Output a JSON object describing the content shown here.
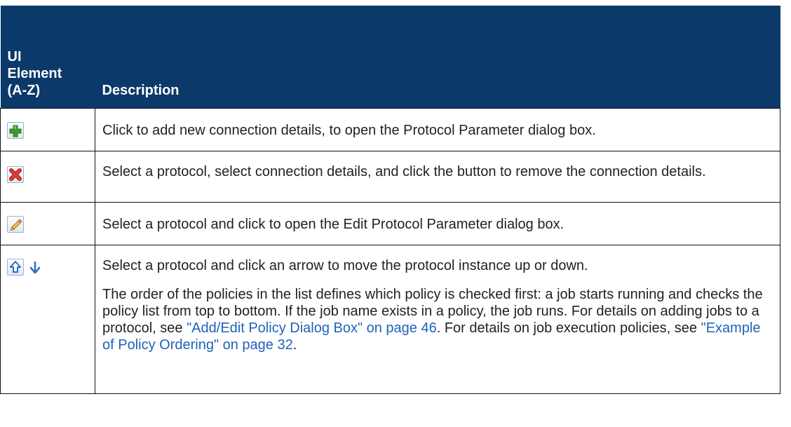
{
  "header": {
    "col1": "UI Element (A-Z)",
    "col1_lines": [
      "UI",
      "Element",
      "(A-Z)"
    ],
    "col2": "Description"
  },
  "rows": [
    {
      "icons": [
        "add-icon"
      ],
      "text": "Click to add new connection details, to open the Protocol Parameter dialog box."
    },
    {
      "icons": [
        "remove-icon"
      ],
      "text": "Select a protocol, select connection details, and click the button to remove the connection details."
    },
    {
      "icons": [
        "edit-icon"
      ],
      "text": "Select a protocol and click to open the Edit Protocol Parameter dialog box."
    },
    {
      "icons": [
        "move-up-icon",
        "move-down-icon"
      ],
      "text": "Select a protocol and click an arrow to move the protocol instance up or down.",
      "para2": {
        "t1": "The order of the policies in the list defines which policy is checked first: a job starts running and checks the policy list from top to bottom. If the job name exists in a policy, the job runs. For details on adding jobs to a protocol, see ",
        "link1": "\"Add/Edit Policy Dialog Box\" on page 46",
        "t2": ". For details on job execution policies, see ",
        "link2": "\"Example of Policy Ordering\" on page 32",
        "t3": "."
      }
    }
  ],
  "colors": {
    "header_bg": "#0b3a6a",
    "header_text": "#ffffff",
    "link": "#1f62b8",
    "add_icon": "#3c9a2a",
    "remove_icon": "#d42a2a",
    "arrow_icon": "#2a6cc4"
  }
}
